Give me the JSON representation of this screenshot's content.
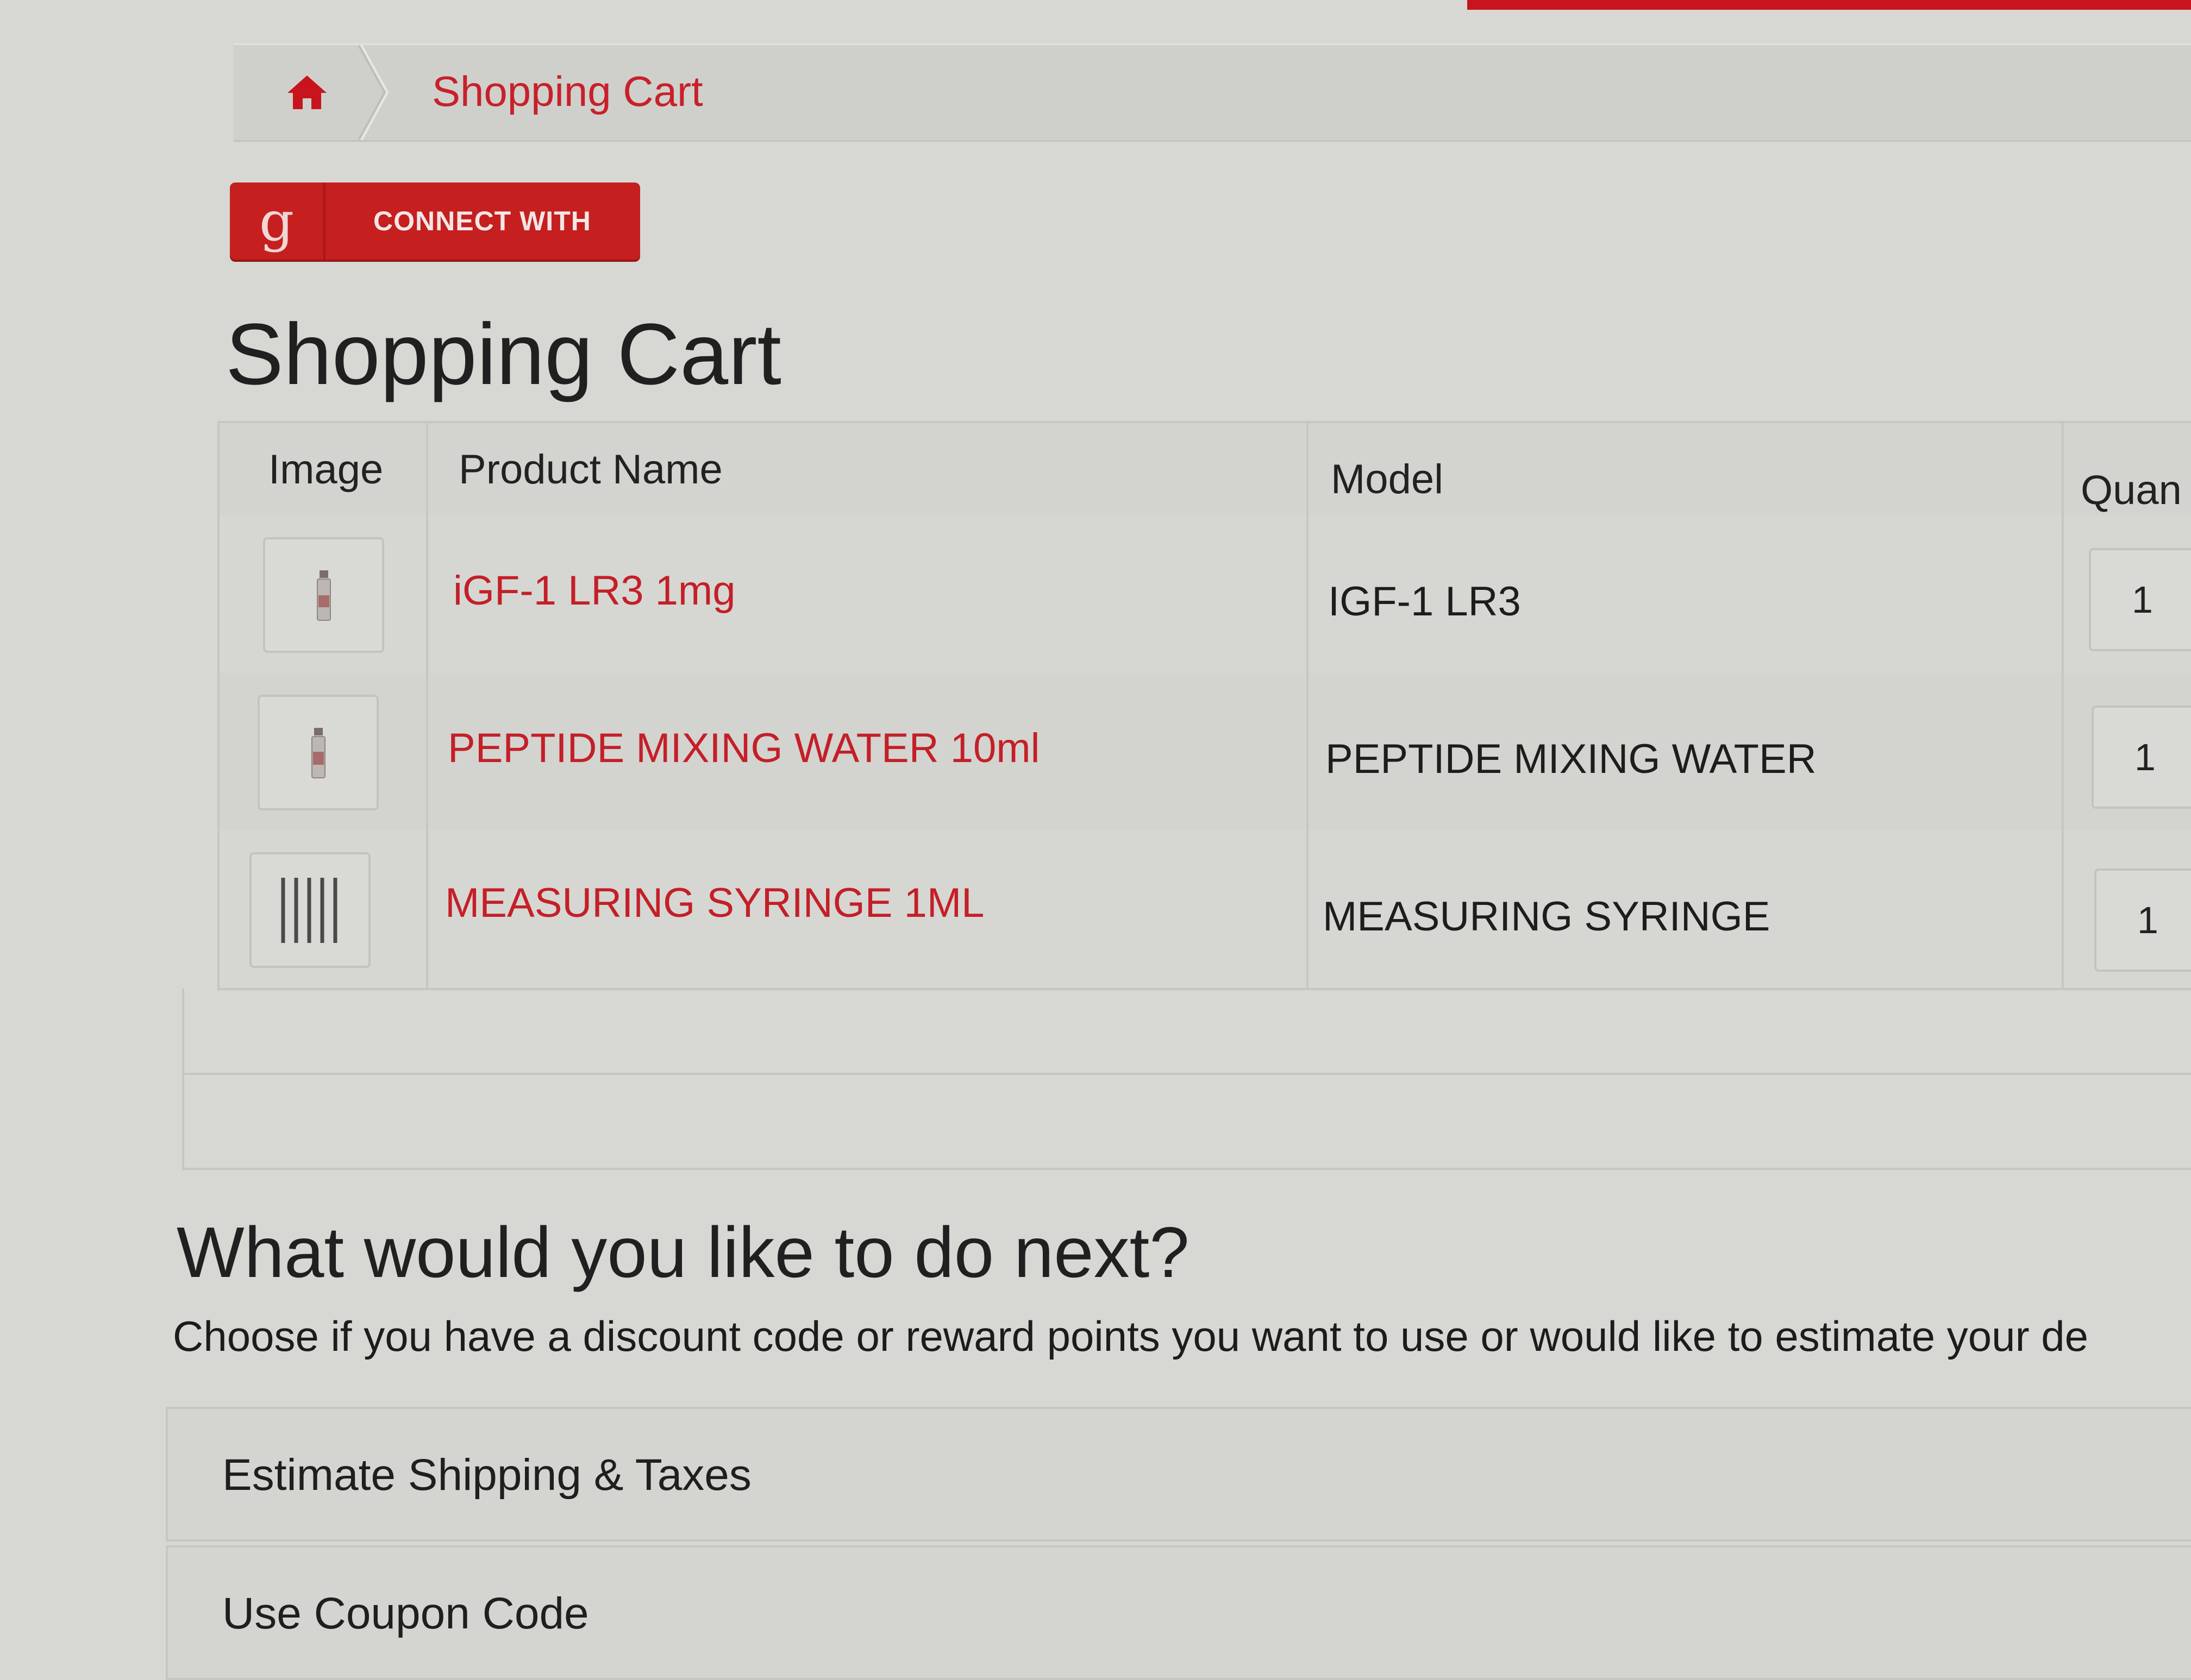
{
  "breadcrumb": {
    "home_icon": "home-icon",
    "current": "Shopping Cart"
  },
  "connect": {
    "icon_text": "g",
    "label": "CONNECT WITH"
  },
  "page_title": "Shopping Cart",
  "table": {
    "headers": [
      "Image",
      "Product Name",
      "Model",
      "Quan"
    ],
    "rows": [
      {
        "image": "vial-thumbnail",
        "product": "iGF-1 LR3 1mg",
        "model": "IGF-1 LR3",
        "quantity": "1"
      },
      {
        "image": "vial-thumbnail",
        "product": "PEPTIDE MIXING WATER 10ml",
        "model": "PEPTIDE MIXING WATER",
        "quantity": "1"
      },
      {
        "image": "syringe-thumbnail",
        "product": "MEASURING SYRINGE 1ML",
        "model": "MEASURING SYRINGE",
        "quantity": "1"
      }
    ]
  },
  "next": {
    "title": "What would you like to do next?",
    "description": "Choose if you have a discount code or reward points you want to use or would like to estimate your de"
  },
  "panels": [
    {
      "title": "Estimate Shipping & Taxes"
    },
    {
      "title": "Use Coupon Code"
    }
  ],
  "colors": {
    "accent_red": "#c51f1f",
    "link_red": "#c41f28",
    "background": "#d7d8d3"
  }
}
